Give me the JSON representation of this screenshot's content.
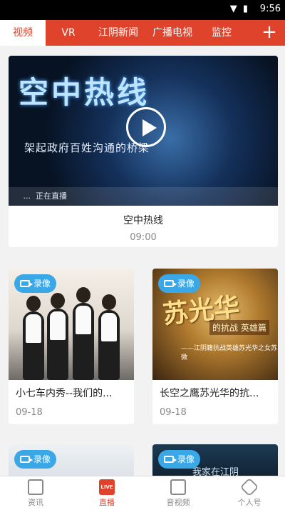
{
  "status": {
    "time": "9:56",
    "icons": "▼ ▮"
  },
  "tabs": [
    {
      "label": "视频"
    },
    {
      "label": "VR"
    },
    {
      "label": "江阴新闻"
    },
    {
      "label": "广播电视"
    },
    {
      "label": "监控"
    }
  ],
  "add_label": "+",
  "main_card": {
    "art_title": "空中热线",
    "art_subtitle": "架起政府百姓沟通的桥梁",
    "art_strip": "   ...  正在直播",
    "title": "空中热线",
    "time": "09:00"
  },
  "cards": [
    {
      "badge": "录像",
      "title": "小七车内秀--我们的...",
      "date": "09-18"
    },
    {
      "badge": "录像",
      "title": "长空之鹰苏光华的抗...",
      "date": "09-18",
      "art": "苏光华",
      "art_sub": "的抗战 英雄篇",
      "art_small": "——江阴籍抗战英雄苏光华之女苏微"
    },
    {
      "badge": "录像"
    },
    {
      "badge": "录像",
      "art": "我家在江阴"
    }
  ],
  "bottom_nav": [
    {
      "label": "资讯",
      "icon": "news-icon"
    },
    {
      "label": "直播",
      "icon": "live-icon",
      "icon_text": "LIVE"
    },
    {
      "label": "音视频",
      "icon": "video-icon"
    },
    {
      "label": "个人号",
      "icon": "profile-icon"
    }
  ],
  "colors": {
    "accent": "#e0432c",
    "badge": "#3aa7e6"
  }
}
